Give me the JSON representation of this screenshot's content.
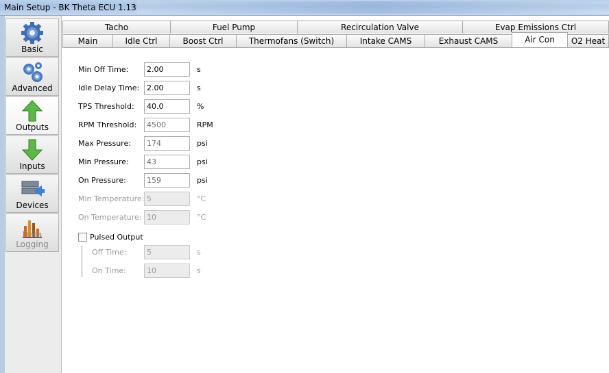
{
  "window": {
    "title": "Main Setup - BK Theta ECU 1.13"
  },
  "sidebar": {
    "items": [
      {
        "label": "Basic",
        "icon": "gear-icon"
      },
      {
        "label": "Advanced",
        "icon": "gears-icon"
      },
      {
        "label": "Outputs",
        "icon": "arrow-up-icon"
      },
      {
        "label": "Inputs",
        "icon": "arrow-down-icon"
      },
      {
        "label": "Devices",
        "icon": "devices-icon"
      },
      {
        "label": "Data Logging",
        "icon": "bar-chart-icon"
      }
    ]
  },
  "tabs": {
    "row1": [
      "Tacho",
      "Fuel Pump",
      "Recirculation Valve",
      "Evap Emissions Ctrl"
    ],
    "row2": [
      "Main",
      "Idle Ctrl",
      "Boost Ctrl",
      "Thermofans (Switch)",
      "Intake CAMS",
      "Exhaust CAMS",
      "Air Con",
      "O2 Heat"
    ],
    "active": "Air Con"
  },
  "aircon": {
    "min_off_time": {
      "label": "Min Off Time:",
      "value": "2.00",
      "unit": "s"
    },
    "idle_delay_time": {
      "label": "Idle Delay Time:",
      "value": "2.00",
      "unit": "s"
    },
    "tps_threshold": {
      "label": "TPS Threshold:",
      "value": "40.0",
      "unit": "%"
    },
    "rpm_threshold": {
      "label": "RPM Threshold:",
      "value": "4500",
      "unit": "RPM"
    },
    "max_pressure": {
      "label": "Max Pressure:",
      "value": "174",
      "unit": "psi"
    },
    "min_pressure": {
      "label": "Min Pressure:",
      "value": "43",
      "unit": "psi"
    },
    "on_pressure": {
      "label": "On Pressure:",
      "value": "159",
      "unit": "psi"
    },
    "min_temperature": {
      "label": "Min Temperature:",
      "value": "5",
      "unit": "°C"
    },
    "on_temperature": {
      "label": "On Temperature:",
      "value": "10",
      "unit": "°C"
    },
    "pulsed_output": {
      "label": "Pulsed Output",
      "checked": false
    },
    "off_time": {
      "label": "Off Time:",
      "value": "5",
      "unit": "s"
    },
    "on_time": {
      "label": "On Time:",
      "value": "10",
      "unit": "s"
    }
  }
}
